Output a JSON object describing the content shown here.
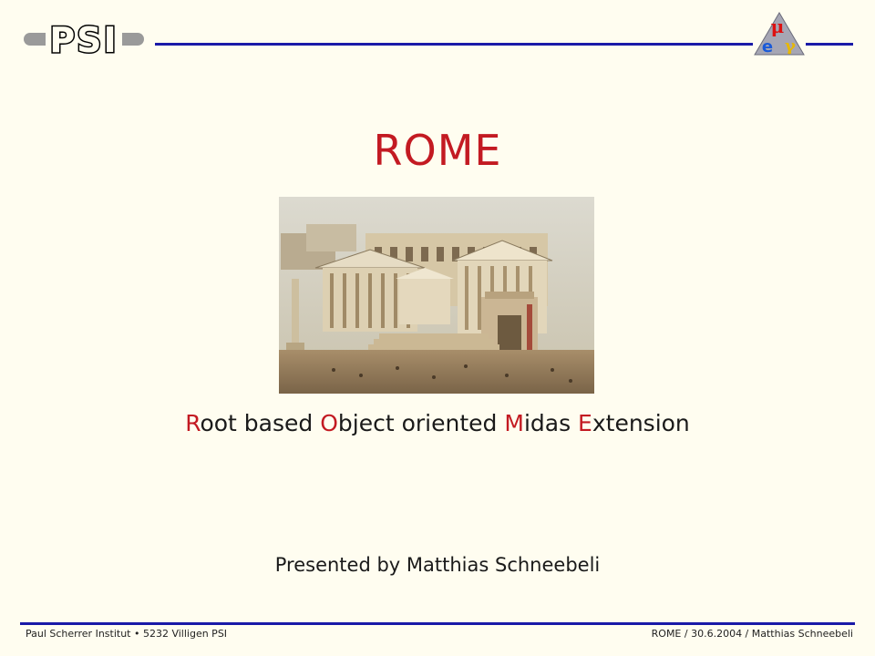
{
  "header": {
    "logo_text": "PSI",
    "meg_logo_symbols": [
      "μ",
      "e",
      "γ"
    ]
  },
  "slide": {
    "title": "ROME",
    "image_alt": "Painting of the Roman Forum with temples and columns",
    "subtitle_parts": [
      {
        "initial": "R",
        "rest": "oot based "
      },
      {
        "initial": "O",
        "rest": "bject oriented "
      },
      {
        "initial": "M",
        "rest": "idas "
      },
      {
        "initial": "E",
        "rest": "xtension"
      }
    ],
    "presenter": "Presented by Matthias Schneebeli"
  },
  "footer": {
    "left": "Paul Scherrer Institut • 5232 Villigen PSI",
    "right": "ROME / 30.6.2004 / Matthias Schneebeli"
  },
  "colors": {
    "accent_red": "#c31a22",
    "rule_blue": "#1a1aa8",
    "background": "#fffdf0"
  }
}
